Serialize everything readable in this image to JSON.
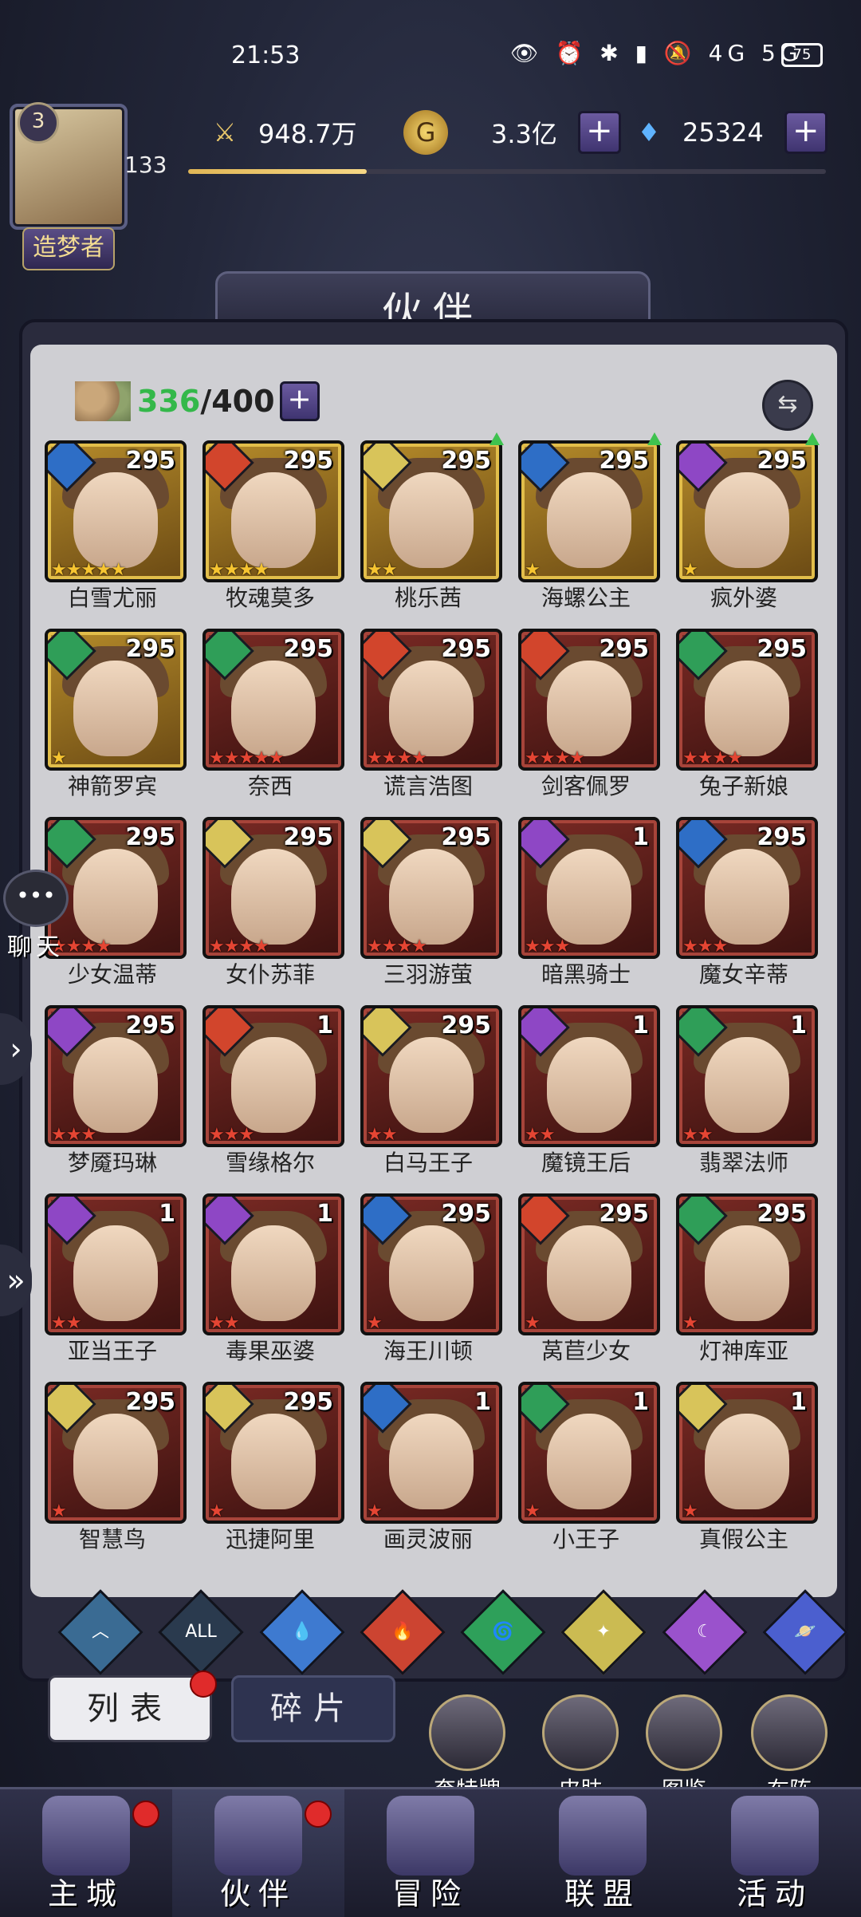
{
  "status": {
    "time": "21:53",
    "icons": "👁 ⏰ ✱ ▮ 🔕 4G 5G",
    "battery": "75"
  },
  "player": {
    "level": "3",
    "power_level": "133",
    "title": "造梦者",
    "exp_progress": 0.28
  },
  "resources": {
    "power": "948.7万",
    "gold": "3.3亿",
    "gems": "25324"
  },
  "header": {
    "title": "伙伴"
  },
  "roster": {
    "current": "336",
    "max": "400"
  },
  "heroes": [
    {
      "name": "白雪尤丽",
      "level": "295",
      "element": "water",
      "frame": "gold",
      "stars": 5,
      "star_color": "gold",
      "up": false
    },
    {
      "name": "牧魂莫多",
      "level": "295",
      "element": "fire",
      "frame": "gold",
      "stars": 4,
      "star_color": "gold",
      "up": false
    },
    {
      "name": "桃乐茜",
      "level": "295",
      "element": "light",
      "frame": "gold",
      "stars": 2,
      "star_color": "gold",
      "up": true
    },
    {
      "name": "海螺公主",
      "level": "295",
      "element": "water",
      "frame": "gold",
      "stars": 1,
      "star_color": "gold",
      "up": true
    },
    {
      "name": "疯外婆",
      "level": "295",
      "element": "dark",
      "frame": "gold",
      "stars": 1,
      "star_color": "gold",
      "up": true
    },
    {
      "name": "神箭罗宾",
      "level": "295",
      "element": "wind",
      "frame": "gold",
      "stars": 1,
      "star_color": "gold",
      "up": false
    },
    {
      "name": "奈西",
      "level": "295",
      "element": "wind",
      "frame": "red",
      "stars": 5,
      "star_color": "red",
      "up": false
    },
    {
      "name": "谎言浩图",
      "level": "295",
      "element": "fire",
      "frame": "red",
      "stars": 4,
      "star_color": "red",
      "up": false
    },
    {
      "name": "剑客佩罗",
      "level": "295",
      "element": "fire",
      "frame": "red",
      "stars": 4,
      "star_color": "red",
      "up": false
    },
    {
      "name": "兔子新娘",
      "level": "295",
      "element": "wind",
      "frame": "red",
      "stars": 4,
      "star_color": "red",
      "up": false
    },
    {
      "name": "少女温蒂",
      "level": "295",
      "element": "wind",
      "frame": "red",
      "stars": 4,
      "star_color": "red",
      "up": false
    },
    {
      "name": "女仆苏菲",
      "level": "295",
      "element": "light",
      "frame": "red",
      "stars": 4,
      "star_color": "red",
      "up": false
    },
    {
      "name": "三羽游萤",
      "level": "295",
      "element": "light",
      "frame": "red",
      "stars": 4,
      "star_color": "red",
      "up": false
    },
    {
      "name": "暗黑骑士",
      "level": "1",
      "element": "dark",
      "frame": "red",
      "stars": 3,
      "star_color": "red",
      "up": false
    },
    {
      "name": "魔女辛蒂",
      "level": "295",
      "element": "water",
      "frame": "red",
      "stars": 3,
      "star_color": "red",
      "up": false
    },
    {
      "name": "梦魇玛琳",
      "level": "295",
      "element": "dark",
      "frame": "red",
      "stars": 3,
      "star_color": "red",
      "up": false
    },
    {
      "name": "雪缘格尔",
      "level": "1",
      "element": "fire",
      "frame": "red",
      "stars": 3,
      "star_color": "red",
      "up": false
    },
    {
      "name": "白马王子",
      "level": "295",
      "element": "light",
      "frame": "red",
      "stars": 2,
      "star_color": "red",
      "up": false
    },
    {
      "name": "魔镜王后",
      "level": "1",
      "element": "dark",
      "frame": "red",
      "stars": 2,
      "star_color": "red",
      "up": false
    },
    {
      "name": "翡翠法师",
      "level": "1",
      "element": "wind",
      "frame": "red",
      "stars": 2,
      "star_color": "red",
      "up": false
    },
    {
      "name": "亚当王子",
      "level": "1",
      "element": "dark",
      "frame": "red",
      "stars": 2,
      "star_color": "red",
      "up": false
    },
    {
      "name": "毒果巫婆",
      "level": "1",
      "element": "dark",
      "frame": "red",
      "stars": 2,
      "star_color": "red",
      "up": false
    },
    {
      "name": "海王川顿",
      "level": "295",
      "element": "water",
      "frame": "red",
      "stars": 1,
      "star_color": "red",
      "up": false
    },
    {
      "name": "莴苣少女",
      "level": "295",
      "element": "fire",
      "frame": "red",
      "stars": 1,
      "star_color": "red",
      "up": false
    },
    {
      "name": "灯神库亚",
      "level": "295",
      "element": "wind",
      "frame": "red",
      "stars": 1,
      "star_color": "red",
      "up": false
    },
    {
      "name": "智慧鸟",
      "level": "295",
      "element": "light",
      "frame": "red",
      "stars": 1,
      "star_color": "red",
      "up": false
    },
    {
      "name": "迅捷阿里",
      "level": "295",
      "element": "light",
      "frame": "red",
      "stars": 1,
      "star_color": "red",
      "up": false
    },
    {
      "name": "画灵波丽",
      "level": "1",
      "element": "water",
      "frame": "red",
      "stars": 1,
      "star_color": "red",
      "up": false
    },
    {
      "name": "小王子",
      "level": "1",
      "element": "wind",
      "frame": "red",
      "stars": 1,
      "star_color": "red",
      "up": false
    },
    {
      "name": "真假公主",
      "level": "1",
      "element": "light",
      "frame": "red",
      "stars": 1,
      "star_color": "red",
      "up": false
    }
  ],
  "filters": [
    {
      "key": "base",
      "label": "︿"
    },
    {
      "key": "all",
      "label": "ALL"
    },
    {
      "key": "water",
      "label": "💧"
    },
    {
      "key": "fire",
      "label": "🔥"
    },
    {
      "key": "wind",
      "label": "🌀"
    },
    {
      "key": "light",
      "label": "✦"
    },
    {
      "key": "dark",
      "label": "☾"
    },
    {
      "key": "planet",
      "label": "🪐"
    }
  ],
  "tabs": {
    "list": "列表",
    "fragments": "碎片"
  },
  "shortcuts": {
    "medal": "奎特牌",
    "skin": "皮肤",
    "codex": "图鉴",
    "formation": "布阵"
  },
  "nav": {
    "city": "主城",
    "partner": "伙伴",
    "adventure": "冒险",
    "alliance": "联盟",
    "events": "活动"
  },
  "chat": {
    "label": "聊天",
    "bubble": "•••"
  }
}
